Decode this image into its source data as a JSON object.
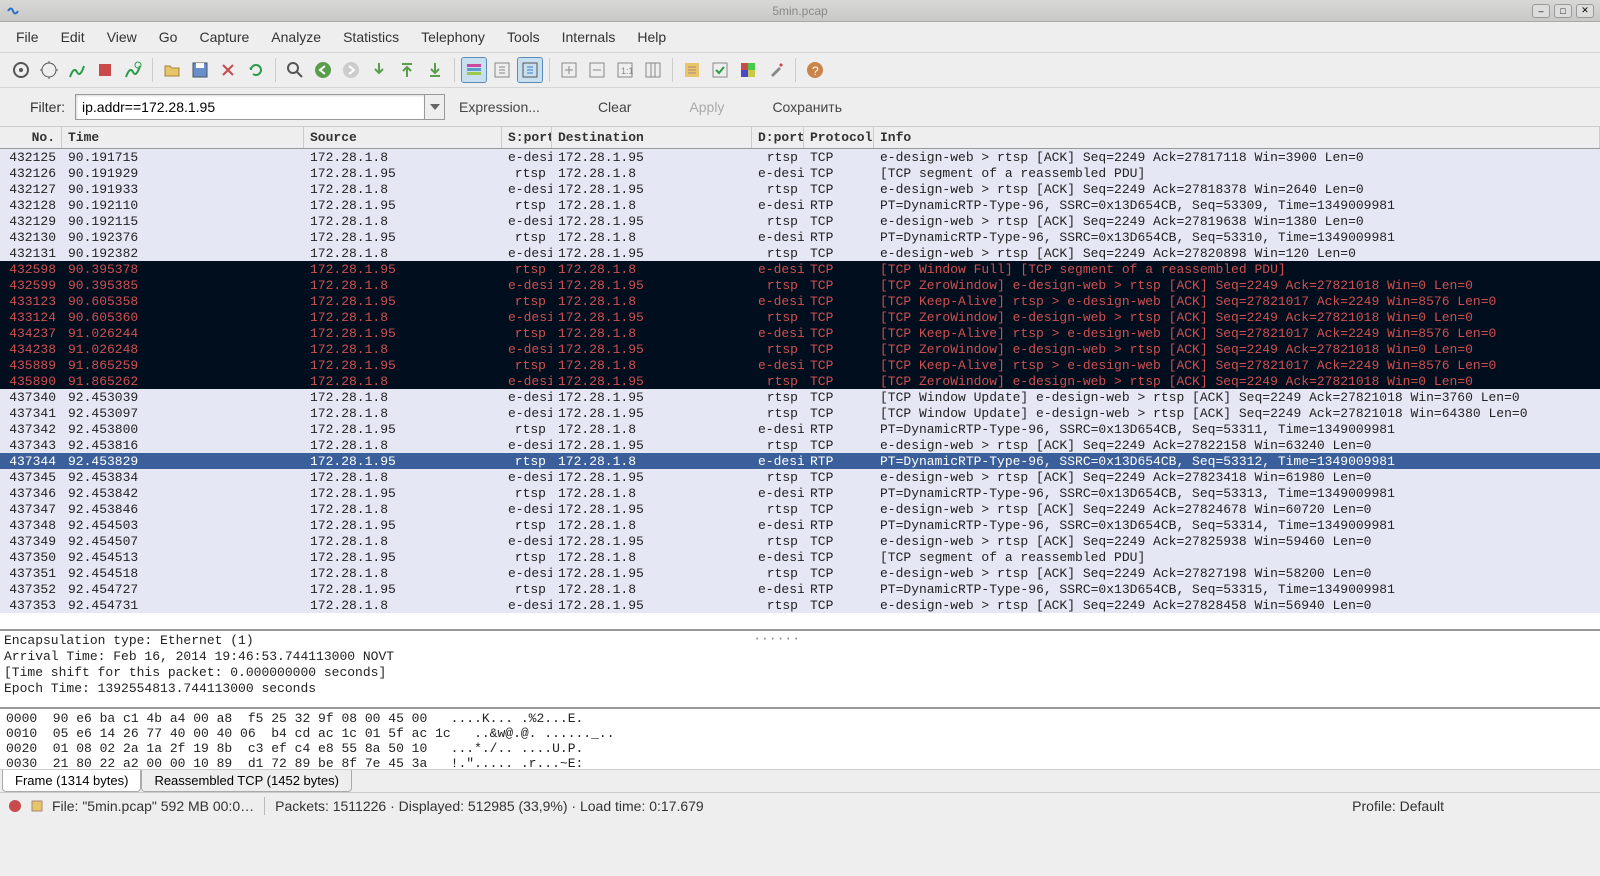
{
  "window": {
    "title": "5min.pcap"
  },
  "menu": [
    "File",
    "Edit",
    "View",
    "Go",
    "Capture",
    "Analyze",
    "Statistics",
    "Telephony",
    "Tools",
    "Internals",
    "Help"
  ],
  "filter": {
    "label": "Filter:",
    "value": "ip.addr==172.28.1.95",
    "expression": "Expression...",
    "clear": "Clear",
    "apply": "Apply",
    "save": "Сохранить"
  },
  "columns": [
    "No.",
    "Time",
    "Source",
    "S:port",
    "Destination",
    "D:port",
    "Protocol",
    "Info"
  ],
  "packets": [
    {
      "no": "432125",
      "time": "90.191715",
      "src": "172.28.1.8",
      "sport": "e-desi",
      "dst": "172.28.1.95",
      "dport": "rtsp",
      "proto": "TCP",
      "info": "e-design-web > rtsp [ACK] Seq=2249 Ack=27817118 Win=3900 Len=0",
      "style": "normal"
    },
    {
      "no": "432126",
      "time": "90.191929",
      "src": "172.28.1.95",
      "sport": "rtsp",
      "dst": "172.28.1.8",
      "dport": "e-desi",
      "proto": "TCP",
      "info": "[TCP segment of a reassembled PDU]",
      "style": "normal"
    },
    {
      "no": "432127",
      "time": "90.191933",
      "src": "172.28.1.8",
      "sport": "e-desi",
      "dst": "172.28.1.95",
      "dport": "rtsp",
      "proto": "TCP",
      "info": "e-design-web > rtsp [ACK] Seq=2249 Ack=27818378 Win=2640 Len=0",
      "style": "normal"
    },
    {
      "no": "432128",
      "time": "90.192110",
      "src": "172.28.1.95",
      "sport": "rtsp",
      "dst": "172.28.1.8",
      "dport": "e-desi",
      "proto": "RTP",
      "info": "PT=DynamicRTP-Type-96, SSRC=0x13D654CB, Seq=53309, Time=1349009981",
      "style": "normal"
    },
    {
      "no": "432129",
      "time": "90.192115",
      "src": "172.28.1.8",
      "sport": "e-desi",
      "dst": "172.28.1.95",
      "dport": "rtsp",
      "proto": "TCP",
      "info": "e-design-web > rtsp [ACK] Seq=2249 Ack=27819638 Win=1380 Len=0",
      "style": "normal"
    },
    {
      "no": "432130",
      "time": "90.192376",
      "src": "172.28.1.95",
      "sport": "rtsp",
      "dst": "172.28.1.8",
      "dport": "e-desi",
      "proto": "RTP",
      "info": "PT=DynamicRTP-Type-96, SSRC=0x13D654CB, Seq=53310, Time=1349009981",
      "style": "normal"
    },
    {
      "no": "432131",
      "time": "90.192382",
      "src": "172.28.1.8",
      "sport": "e-desi",
      "dst": "172.28.1.95",
      "dport": "rtsp",
      "proto": "TCP",
      "info": "e-design-web > rtsp [ACK] Seq=2249 Ack=27820898 Win=120 Len=0",
      "style": "normal"
    },
    {
      "no": "432598",
      "time": "90.395378",
      "src": "172.28.1.95",
      "sport": "rtsp",
      "dst": "172.28.1.8",
      "dport": "e-desi",
      "proto": "TCP",
      "info": "[TCP Window Full] [TCP segment of a reassembled PDU]",
      "style": "dark"
    },
    {
      "no": "432599",
      "time": "90.395385",
      "src": "172.28.1.8",
      "sport": "e-desi",
      "dst": "172.28.1.95",
      "dport": "rtsp",
      "proto": "TCP",
      "info": "[TCP ZeroWindow] e-design-web > rtsp [ACK] Seq=2249 Ack=27821018 Win=0 Len=0",
      "style": "dark"
    },
    {
      "no": "433123",
      "time": "90.605358",
      "src": "172.28.1.95",
      "sport": "rtsp",
      "dst": "172.28.1.8",
      "dport": "e-desi",
      "proto": "TCP",
      "info": "[TCP Keep-Alive] rtsp > e-design-web [ACK] Seq=27821017 Ack=2249 Win=8576 Len=0",
      "style": "dark"
    },
    {
      "no": "433124",
      "time": "90.605360",
      "src": "172.28.1.8",
      "sport": "e-desi",
      "dst": "172.28.1.95",
      "dport": "rtsp",
      "proto": "TCP",
      "info": "[TCP ZeroWindow] e-design-web > rtsp [ACK] Seq=2249 Ack=27821018 Win=0 Len=0",
      "style": "dark"
    },
    {
      "no": "434237",
      "time": "91.026244",
      "src": "172.28.1.95",
      "sport": "rtsp",
      "dst": "172.28.1.8",
      "dport": "e-desi",
      "proto": "TCP",
      "info": "[TCP Keep-Alive] rtsp > e-design-web [ACK] Seq=27821017 Ack=2249 Win=8576 Len=0",
      "style": "dark"
    },
    {
      "no": "434238",
      "time": "91.026248",
      "src": "172.28.1.8",
      "sport": "e-desi",
      "dst": "172.28.1.95",
      "dport": "rtsp",
      "proto": "TCP",
      "info": "[TCP ZeroWindow] e-design-web > rtsp [ACK] Seq=2249 Ack=27821018 Win=0 Len=0",
      "style": "dark"
    },
    {
      "no": "435889",
      "time": "91.865259",
      "src": "172.28.1.95",
      "sport": "rtsp",
      "dst": "172.28.1.8",
      "dport": "e-desi",
      "proto": "TCP",
      "info": "[TCP Keep-Alive] rtsp > e-design-web [ACK] Seq=27821017 Ack=2249 Win=8576 Len=0",
      "style": "dark"
    },
    {
      "no": "435890",
      "time": "91.865262",
      "src": "172.28.1.8",
      "sport": "e-desi",
      "dst": "172.28.1.95",
      "dport": "rtsp",
      "proto": "TCP",
      "info": "[TCP ZeroWindow] e-design-web > rtsp [ACK] Seq=2249 Ack=27821018 Win=0 Len=0",
      "style": "dark"
    },
    {
      "no": "437340",
      "time": "92.453039",
      "src": "172.28.1.8",
      "sport": "e-desi",
      "dst": "172.28.1.95",
      "dport": "rtsp",
      "proto": "TCP",
      "info": "[TCP Window Update] e-design-web > rtsp [ACK] Seq=2249 Ack=27821018 Win=3760 Len=0",
      "style": "normal"
    },
    {
      "no": "437341",
      "time": "92.453097",
      "src": "172.28.1.8",
      "sport": "e-desi",
      "dst": "172.28.1.95",
      "dport": "rtsp",
      "proto": "TCP",
      "info": "[TCP Window Update] e-design-web > rtsp [ACK] Seq=2249 Ack=27821018 Win=64380 Len=0",
      "style": "normal"
    },
    {
      "no": "437342",
      "time": "92.453800",
      "src": "172.28.1.95",
      "sport": "rtsp",
      "dst": "172.28.1.8",
      "dport": "e-desi",
      "proto": "RTP",
      "info": "PT=DynamicRTP-Type-96, SSRC=0x13D654CB, Seq=53311, Time=1349009981",
      "style": "normal"
    },
    {
      "no": "437343",
      "time": "92.453816",
      "src": "172.28.1.8",
      "sport": "e-desi",
      "dst": "172.28.1.95",
      "dport": "rtsp",
      "proto": "TCP",
      "info": "e-design-web > rtsp [ACK] Seq=2249 Ack=27822158 Win=63240 Len=0",
      "style": "normal"
    },
    {
      "no": "437344",
      "time": "92.453829",
      "src": "172.28.1.95",
      "sport": "rtsp",
      "dst": "172.28.1.8",
      "dport": "e-desi",
      "proto": "RTP",
      "info": "PT=DynamicRTP-Type-96, SSRC=0x13D654CB, Seq=53312, Time=1349009981",
      "style": "selected"
    },
    {
      "no": "437345",
      "time": "92.453834",
      "src": "172.28.1.8",
      "sport": "e-desi",
      "dst": "172.28.1.95",
      "dport": "rtsp",
      "proto": "TCP",
      "info": "e-design-web > rtsp [ACK] Seq=2249 Ack=27823418 Win=61980 Len=0",
      "style": "normal"
    },
    {
      "no": "437346",
      "time": "92.453842",
      "src": "172.28.1.95",
      "sport": "rtsp",
      "dst": "172.28.1.8",
      "dport": "e-desi",
      "proto": "RTP",
      "info": "PT=DynamicRTP-Type-96, SSRC=0x13D654CB, Seq=53313, Time=1349009981",
      "style": "normal"
    },
    {
      "no": "437347",
      "time": "92.453846",
      "src": "172.28.1.8",
      "sport": "e-desi",
      "dst": "172.28.1.95",
      "dport": "rtsp",
      "proto": "TCP",
      "info": "e-design-web > rtsp [ACK] Seq=2249 Ack=27824678 Win=60720 Len=0",
      "style": "normal"
    },
    {
      "no": "437348",
      "time": "92.454503",
      "src": "172.28.1.95",
      "sport": "rtsp",
      "dst": "172.28.1.8",
      "dport": "e-desi",
      "proto": "RTP",
      "info": "PT=DynamicRTP-Type-96, SSRC=0x13D654CB, Seq=53314, Time=1349009981",
      "style": "normal"
    },
    {
      "no": "437349",
      "time": "92.454507",
      "src": "172.28.1.8",
      "sport": "e-desi",
      "dst": "172.28.1.95",
      "dport": "rtsp",
      "proto": "TCP",
      "info": "e-design-web > rtsp [ACK] Seq=2249 Ack=27825938 Win=59460 Len=0",
      "style": "normal"
    },
    {
      "no": "437350",
      "time": "92.454513",
      "src": "172.28.1.95",
      "sport": "rtsp",
      "dst": "172.28.1.8",
      "dport": "e-desi",
      "proto": "TCP",
      "info": "[TCP segment of a reassembled PDU]",
      "style": "normal"
    },
    {
      "no": "437351",
      "time": "92.454518",
      "src": "172.28.1.8",
      "sport": "e-desi",
      "dst": "172.28.1.95",
      "dport": "rtsp",
      "proto": "TCP",
      "info": "e-design-web > rtsp [ACK] Seq=2249 Ack=27827198 Win=58200 Len=0",
      "style": "normal"
    },
    {
      "no": "437352",
      "time": "92.454727",
      "src": "172.28.1.95",
      "sport": "rtsp",
      "dst": "172.28.1.8",
      "dport": "e-desi",
      "proto": "RTP",
      "info": "PT=DynamicRTP-Type-96, SSRC=0x13D654CB, Seq=53315, Time=1349009981",
      "style": "normal"
    },
    {
      "no": "437353",
      "time": "92.454731",
      "src": "172.28.1.8",
      "sport": "e-desi",
      "dst": "172.28.1.95",
      "dport": "rtsp",
      "proto": "TCP",
      "info": "e-design-web > rtsp [ACK] Seq=2249 Ack=27828458 Win=56940 Len=0",
      "style": "normal"
    }
  ],
  "detail_lines": [
    "  Encapsulation type: Ethernet (1)",
    "  Arrival Time: Feb 16, 2014 19:46:53.744113000 NOVT",
    "  [Time shift for this packet: 0.000000000 seconds]",
    "  Epoch Time: 1392554813.744113000 seconds"
  ],
  "hex_lines": [
    "0000  90 e6 ba c1 4b a4 00 a8  f5 25 32 9f 08 00 45 00   ....K... .%2...E.",
    "0010  05 e6 14 26 77 40 00 40 06  b4 cd ac 1c 01 5f ac 1c   ..&w@.@. ......_..",
    "0020  01 08 02 2a 1a 2f 19 8b  c3 ef c4 e8 55 8a 50 10   ...*./.. ....U.P.",
    "0030  21 80 22 a2 00 00 10 89  d1 72 89 be 8f 7e 45 3a   !.\"..... .r...~E:"
  ],
  "tabs": {
    "frame": "Frame (1314 bytes)",
    "reasm": "Reassembled TCP (1452 bytes)"
  },
  "status": {
    "file": "File: \"5min.pcap\" 592 MB 00:0…",
    "packets": "Packets: 1511226 · Displayed: 512985 (33,9%)  · Load time: 0:17.679",
    "profile": "Profile: Default"
  }
}
